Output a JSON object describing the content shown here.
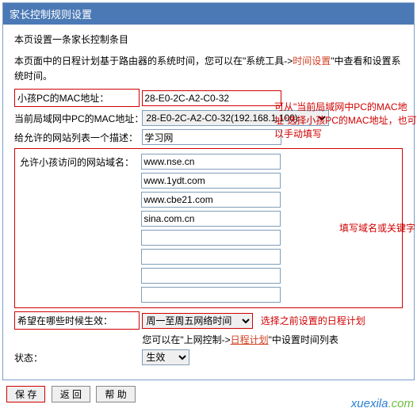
{
  "title": "家长控制规则设置",
  "heading": "本页设置一条家长控制条目",
  "intro_1": "本页面中的日程计划基于路由器的系统时间，您可以在\"系统工具->",
  "intro_link": "时间设置",
  "intro_2": "\"中查看和设置系统时间。",
  "note_mac": "可从\"当前局域网中PC的MAC地址\"选择小孩PC的MAC地址，也可以手动填写",
  "note_domain": "填写域名或关键字",
  "note_schedule": "选择之前设置的日程计划",
  "schedule_hint_1": "您可以在\"上网控制->",
  "schedule_hint_link": "日程计划",
  "schedule_hint_2": "\"中设置时间列表",
  "labels": {
    "child_mac": "小孩PC的MAC地址：",
    "current_mac": "当前局域网中PC的MAC地址：",
    "desc": "给允许的网站列表一个描述：",
    "allowed_domain": "允许小孩访问的网站域名：",
    "effective": "希望在哪些时候生效：",
    "status": "状态："
  },
  "values": {
    "child_mac": "28-E0-2C-A2-C0-32",
    "current_mac": "28-E0-2C-A2-C0-32(192.168.1.100)",
    "desc": "学习网",
    "effective": "周一至周五网络时间",
    "status": "生效"
  },
  "domains": [
    "www.nse.cn",
    "www.1ydt.com",
    "www.cbe21.com",
    "sina.com.cn",
    "",
    "",
    "",
    ""
  ],
  "buttons": {
    "save": "保 存",
    "back": "返 回",
    "help": "帮 助"
  },
  "watermark": {
    "a": "xuexila",
    "b": ".com"
  }
}
